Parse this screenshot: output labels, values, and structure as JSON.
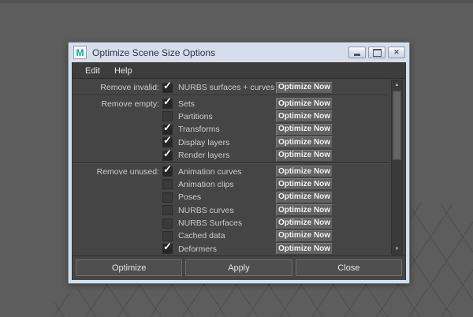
{
  "window": {
    "title": "Optimize Scene Size Options",
    "maya_icon_letter": "M",
    "maya_icon_color": "#1ca69c",
    "close_glyph": "✕"
  },
  "menu": {
    "items": [
      "Edit",
      "Help"
    ]
  },
  "panel": {
    "row_button_label": "Optimize Now",
    "check_glyph": "✓",
    "scroll_up_glyph": "▲",
    "scroll_down_glyph": "▼",
    "sections": [
      {
        "label": "Remove invalid:",
        "items": [
          {
            "label": "NURBS surfaces + curves",
            "checked": true
          }
        ]
      },
      {
        "label": "Remove empty:",
        "items": [
          {
            "label": "Sets",
            "checked": true
          },
          {
            "label": "Partitions",
            "checked": false
          },
          {
            "label": "Transforms",
            "checked": true
          },
          {
            "label": "Display layers",
            "checked": true
          },
          {
            "label": "Render layers",
            "checked": true
          }
        ]
      },
      {
        "label": "Remove unused:",
        "items": [
          {
            "label": "Animation curves",
            "checked": true
          },
          {
            "label": "Animation clips",
            "checked": false
          },
          {
            "label": "Poses",
            "checked": false
          },
          {
            "label": "NURBS curves",
            "checked": false
          },
          {
            "label": "NURBS Surfaces",
            "checked": false
          },
          {
            "label": "Cached data",
            "checked": false
          },
          {
            "label": "Deformers",
            "checked": true
          }
        ]
      }
    ]
  },
  "footer": {
    "buttons": [
      "Optimize",
      "Apply",
      "Close"
    ]
  },
  "colors": {
    "desktop_bg": "#5d5d5d",
    "dialog_bg": "#454545",
    "titlebar_bg": "#d5deea",
    "menubar_bg": "#3d3d3d",
    "text": "#cccccc"
  }
}
